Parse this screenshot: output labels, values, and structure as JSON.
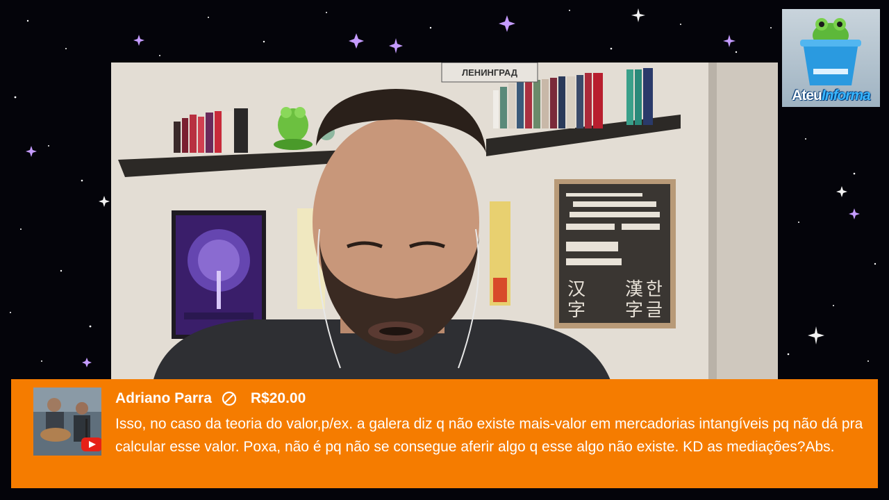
{
  "channel_logo": {
    "word1": "Ateu",
    "word2": "Informa"
  },
  "video": {
    "poster_sign": "ЛЕНИНГРАД"
  },
  "superchat": {
    "author": "Adriano Parra",
    "amount": "R$20.00",
    "message": "Isso, no caso da teoria do valor,p/ex. a galera diz q não existe mais-valor em mercadorias intangíveis pq não dá pra calcular esse valor. Poxa, não é pq não se consegue aferir algo q esse algo não existe. KD as mediações?Abs.",
    "background_color": "#f57c00",
    "badge_icon": "youtube-icon"
  }
}
